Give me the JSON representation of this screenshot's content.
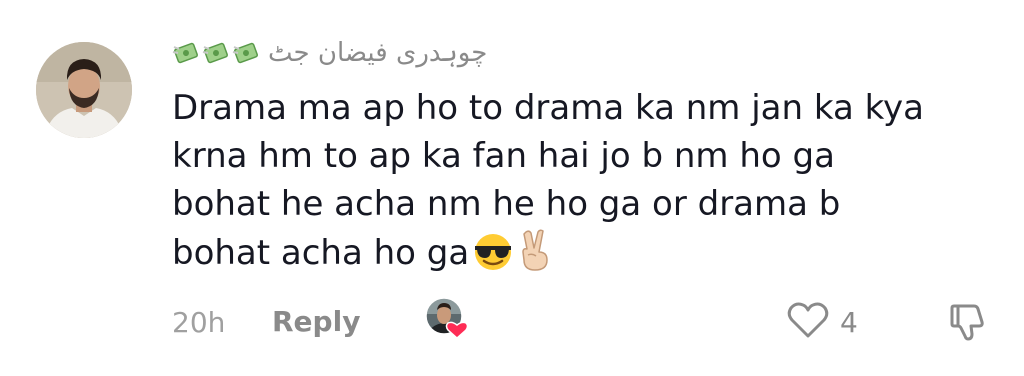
{
  "comment": {
    "username": "چوہدری فیضان جٹ",
    "username_decoration_icons": [
      "money-with-wings-icon",
      "money-with-wings-icon",
      "money-with-wings-icon"
    ],
    "text_lines": [
      "Drama ma ap ho to drama ka nm jan ka kya",
      "krna hm to ap ka fan hai jo b nm ho ga",
      "bohat he acha nm he ho ga or drama b",
      "bohat acha ho ga"
    ],
    "text_trailing_emojis": [
      "smiling-face-with-sunglasses-icon",
      "victory-hand-icon"
    ],
    "time": "20h",
    "reply_label": "Reply",
    "like_count": "4"
  },
  "colors": {
    "text_primary": "#161823",
    "text_secondary": "#8a8a8a",
    "heart_red": "#fe2c55"
  }
}
